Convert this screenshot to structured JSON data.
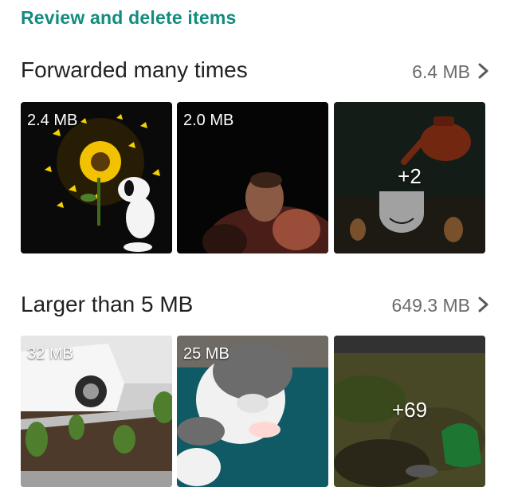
{
  "header": {
    "title": "Review and delete items"
  },
  "groups": [
    {
      "title": "Forwarded many times",
      "size": "6.4 MB",
      "tiles": [
        {
          "label": "2.4 MB"
        },
        {
          "label": "2.0 MB"
        },
        {
          "more": "+2"
        }
      ]
    },
    {
      "title": "Larger than 5 MB",
      "size": "649.3 MB",
      "tiles": [
        {
          "label": "32 MB"
        },
        {
          "label": "25 MB"
        },
        {
          "more": "+69"
        }
      ]
    }
  ],
  "colors": {
    "accent": "#128c7e",
    "title": "#222222",
    "meta": "#6b6b6b"
  },
  "icons": {
    "open_group": "chevron-right-icon"
  }
}
